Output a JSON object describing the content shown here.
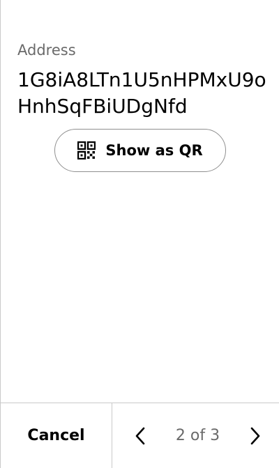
{
  "address": {
    "label": "Address",
    "value": "1G8iA8LTn1U5nHPMxU9oHnhSqFBiUDgNfd"
  },
  "qr_button": {
    "label": "Show as QR",
    "icon": "qr-code-icon"
  },
  "footer": {
    "cancel_label": "Cancel",
    "page_indicator": "2 of 3",
    "prev_icon": "chevron-left-icon",
    "next_icon": "chevron-right-icon"
  }
}
